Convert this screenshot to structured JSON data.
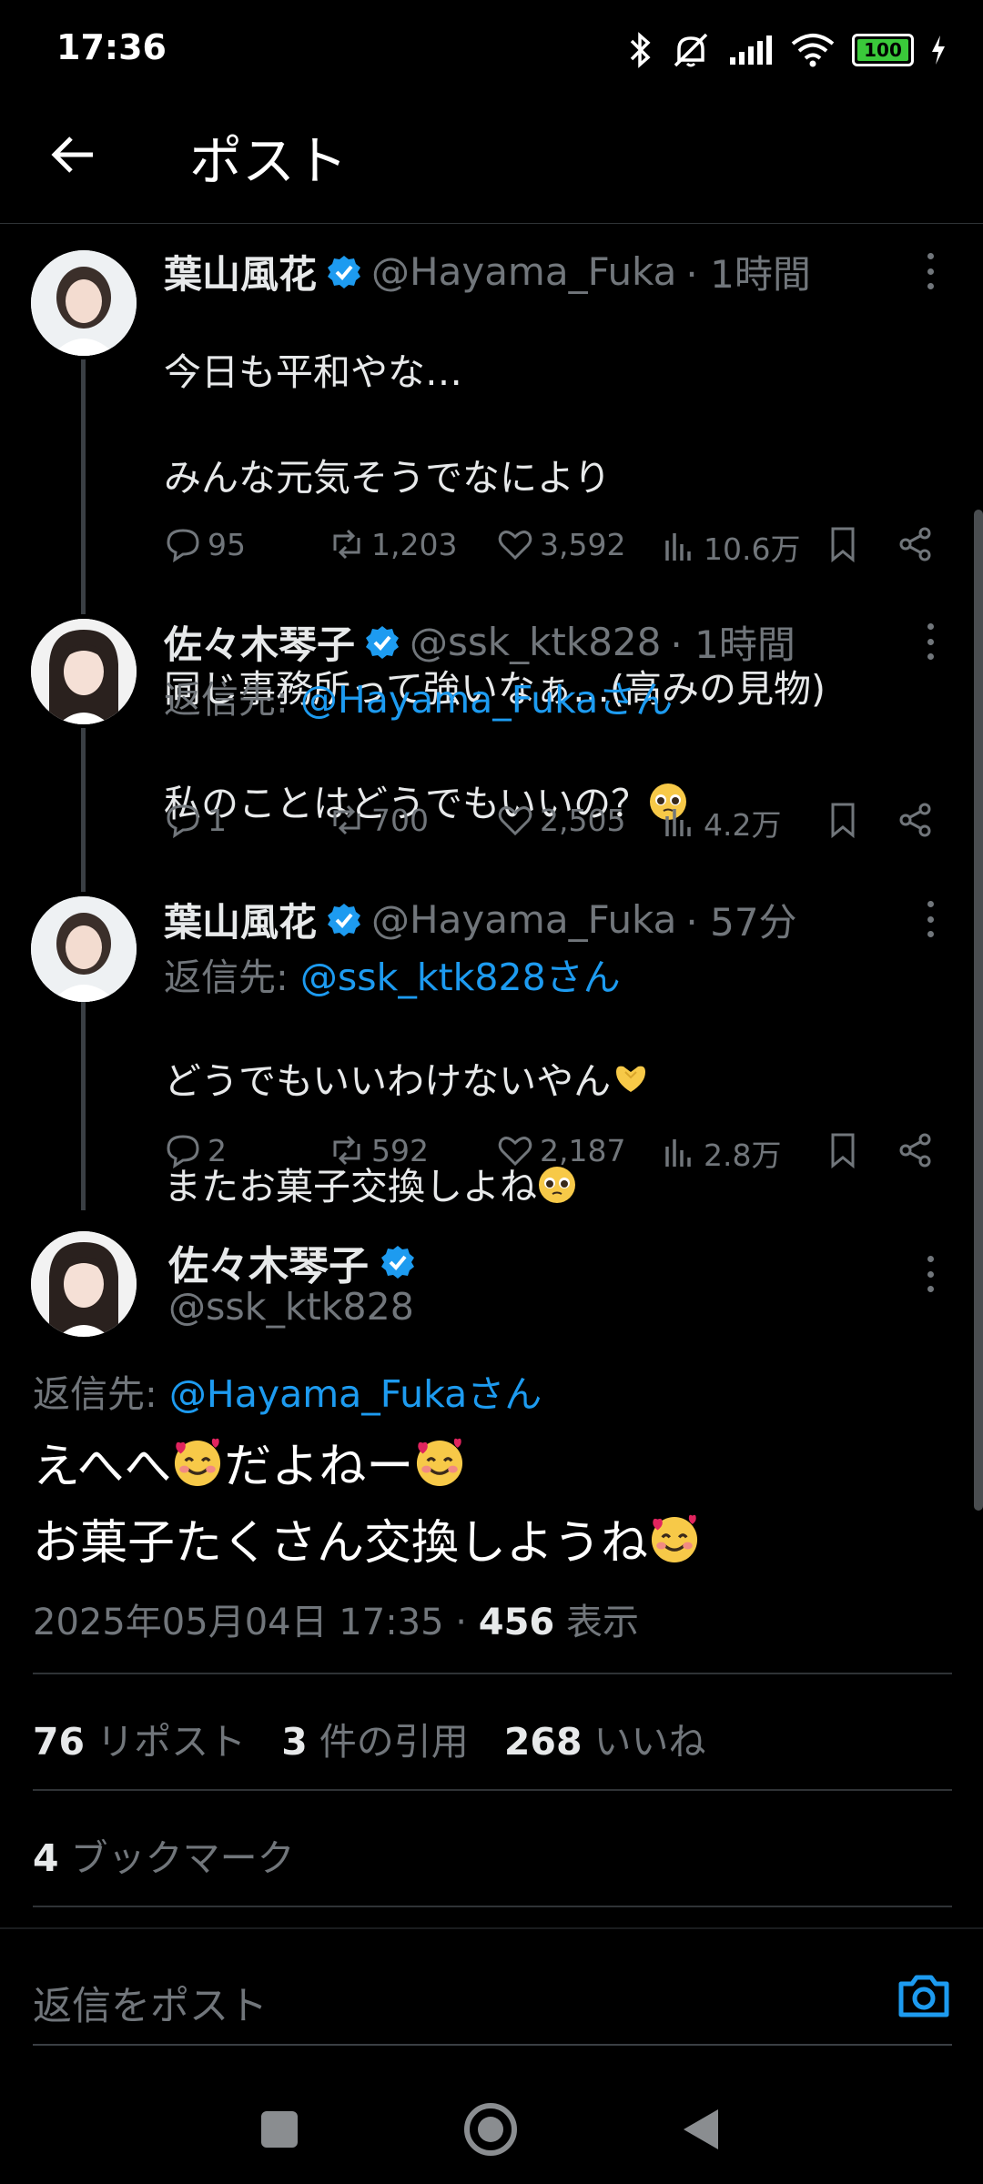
{
  "status_bar": {
    "time": "17:36",
    "battery": "100"
  },
  "header": {
    "title": "ポスト"
  },
  "thread": [
    {
      "name": "葉山風花",
      "handle": "@Hayama_Fuka",
      "time": "· 1時間",
      "reply_to_label": "",
      "reply_to_handle": "",
      "text_lines": [
        "今日も平和やな…",
        "みんな元気そうでなにより",
        "",
        "同じ事務所って強いなぁ…(高みの見物)"
      ],
      "replies": "95",
      "reposts": "1,203",
      "likes": "3,592",
      "views": "10.6万"
    },
    {
      "name": "佐々木琴子",
      "handle": "@ssk_ktk828",
      "time": "· 1時間",
      "reply_to_label": "返信先:",
      "reply_to_handle": "@Hayama_Fukaさん",
      "text_lines": [
        "私のことはどうでもいいの？"
      ],
      "replies": "1",
      "reposts": "700",
      "likes": "2,505",
      "views": "4.2万"
    },
    {
      "name": "葉山風花",
      "handle": "@Hayama_Fuka",
      "time": "· 57分",
      "reply_to_label": "返信先:",
      "reply_to_handle": "@ssk_ktk828さん",
      "text_lines": [
        "どうでもいいわけないやん",
        "またお菓子交換しよね"
      ],
      "replies": "2",
      "reposts": "592",
      "likes": "2,187",
      "views": "2.8万"
    }
  ],
  "main_tweet": {
    "name": "佐々木琴子",
    "handle": "@ssk_ktk828",
    "reply_to_label": "返信先:",
    "reply_to_handle": "@Hayama_Fukaさん",
    "line1a": "えへへ",
    "line1b": "だよねー",
    "line2": "お菓子たくさん交換しようね",
    "datetime": "2025年05月04日 17:35 · ",
    "views_count": "456",
    "views_label": " 表示",
    "reposts_count": "76",
    "reposts_label": " リポスト",
    "quotes_count": "3",
    "quotes_label": " 件の引用",
    "likes_count": "268",
    "likes_label": " いいね",
    "bookmarks_count": "4",
    "bookmarks_label": " ブックマーク"
  },
  "reply_bar": {
    "placeholder": "返信をポスト"
  },
  "colors": {
    "accent": "#1d9bf0",
    "muted": "#71767b",
    "background": "#000000"
  }
}
